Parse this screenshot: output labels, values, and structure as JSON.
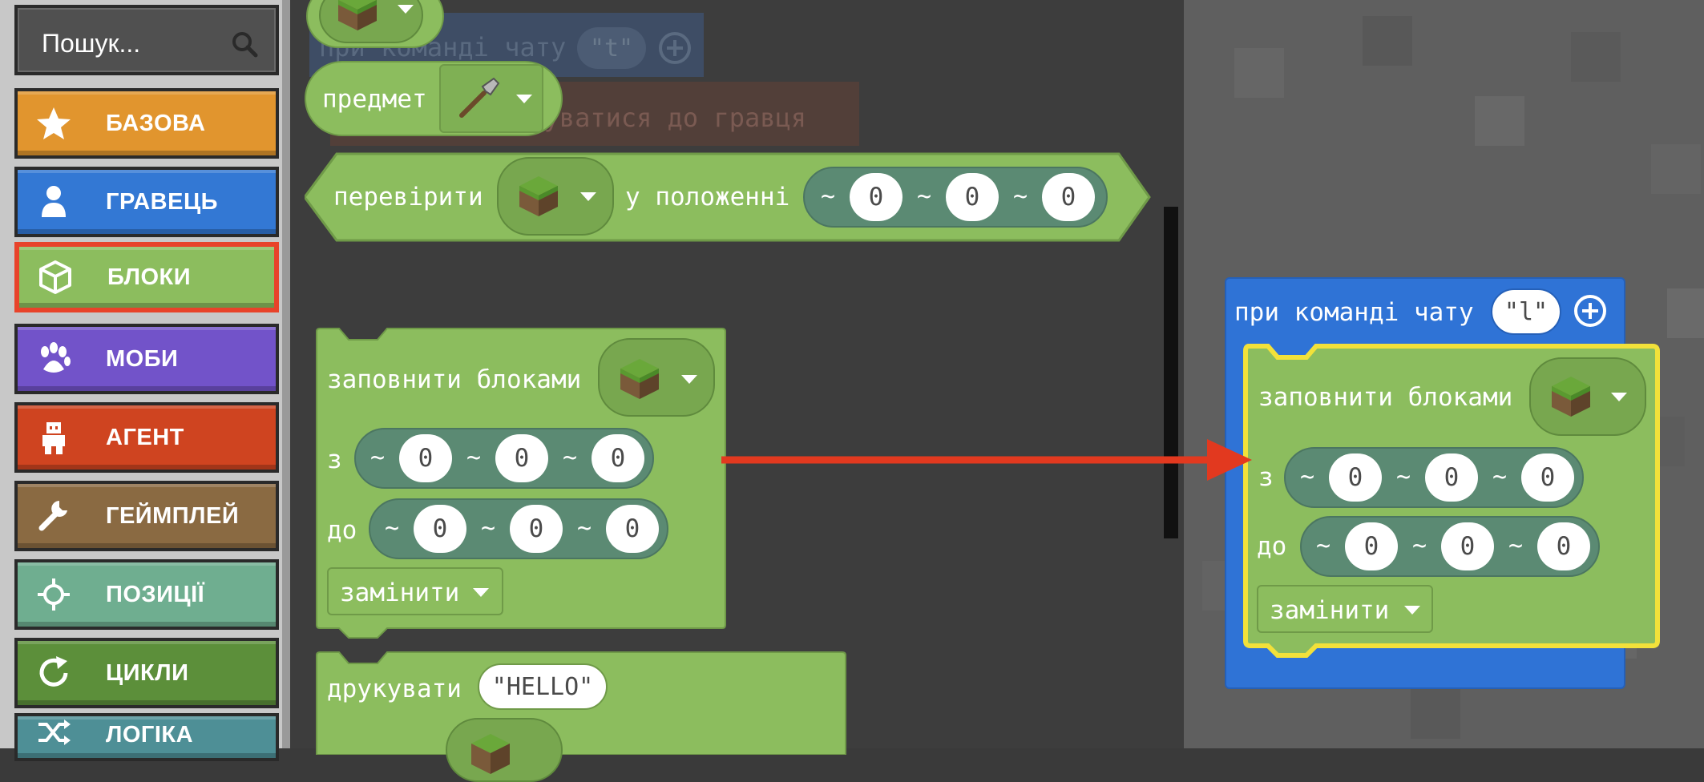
{
  "search": {
    "placeholder": "Пошук..."
  },
  "categories": [
    {
      "label": "БАЗОВА",
      "icon": "star-icon",
      "color": "#e1952e"
    },
    {
      "label": "ГРАВЕЦЬ",
      "icon": "person-icon",
      "color": "#3378d4"
    },
    {
      "label": "БЛОКИ",
      "icon": "cube-icon",
      "color": "#8cbd5e"
    },
    {
      "label": "МОБИ",
      "icon": "paw-icon",
      "color": "#7253c9"
    },
    {
      "label": "АГЕНТ",
      "icon": "agent-icon",
      "color": "#cf4420"
    },
    {
      "label": "ГЕЙМПЛЕЙ",
      "icon": "wrench-icon",
      "color": "#8a6a42"
    },
    {
      "label": "ПОЗИЦІЇ",
      "icon": "crosshair-icon",
      "color": "#6fae90"
    },
    {
      "label": "ЦИКЛИ",
      "icon": "loop-icon",
      "color": "#5c8f3a"
    },
    {
      "label": "ЛОГІКА",
      "icon": "shuffle-icon",
      "color": "#4e8f96"
    }
  ],
  "workspace": {
    "faint_chat_label": "при команді чату",
    "faint_chat_value": "\"t\"",
    "faint_teleport": "ртуватися до гравця",
    "item_label": "предмет",
    "check_label": "перевірити",
    "check_position_label": "у положенні",
    "fill_label": "заповнити блоками",
    "from_label": "з",
    "to_label": "до",
    "replace_label": "замінити",
    "print_label": "друкувати",
    "print_value": "\"HELLO\"",
    "tilde": "~",
    "zero": "0",
    "chat_label": "при команді чату",
    "chat_value": "\"l\""
  }
}
